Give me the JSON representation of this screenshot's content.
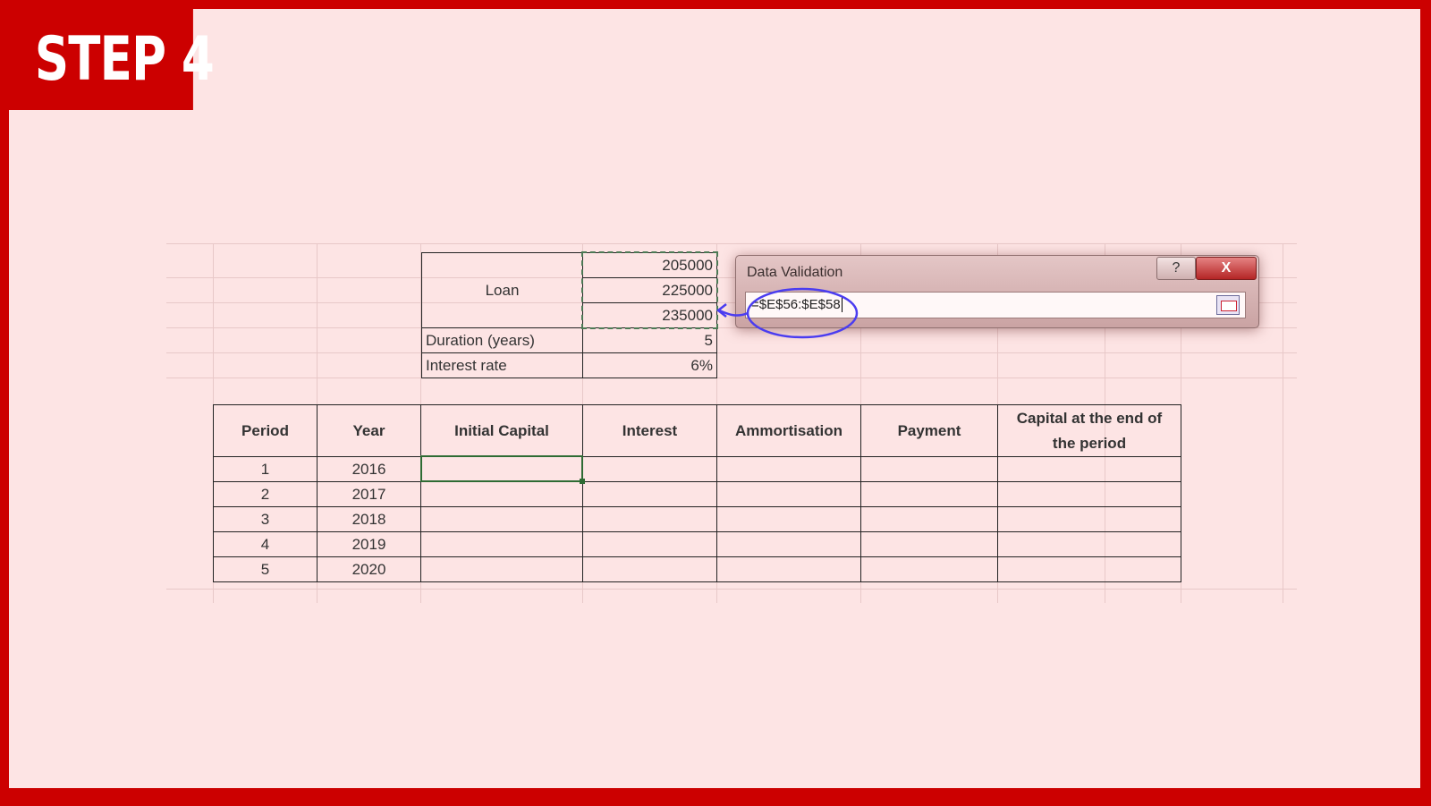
{
  "step_label": "STEP 4",
  "inputs": {
    "loan_label": "Loan",
    "loan_values": [
      "205000",
      "225000",
      "235000"
    ],
    "duration_label": "Duration (years)",
    "duration_value": "5",
    "rate_label": "Interest rate",
    "rate_value": "6%"
  },
  "table": {
    "headers": [
      "Period",
      "Year",
      "Initial Capital",
      "Interest",
      "Ammortisation",
      "Payment",
      "Capital at the end of the period"
    ],
    "rows": [
      [
        "1",
        "2016"
      ],
      [
        "2",
        "2017"
      ],
      [
        "3",
        "2018"
      ],
      [
        "4",
        "2019"
      ],
      [
        "5",
        "2020"
      ]
    ]
  },
  "dialog": {
    "title": "Data Validation",
    "help": "?",
    "close": "X",
    "formula": "=$E$56:$E$58"
  }
}
